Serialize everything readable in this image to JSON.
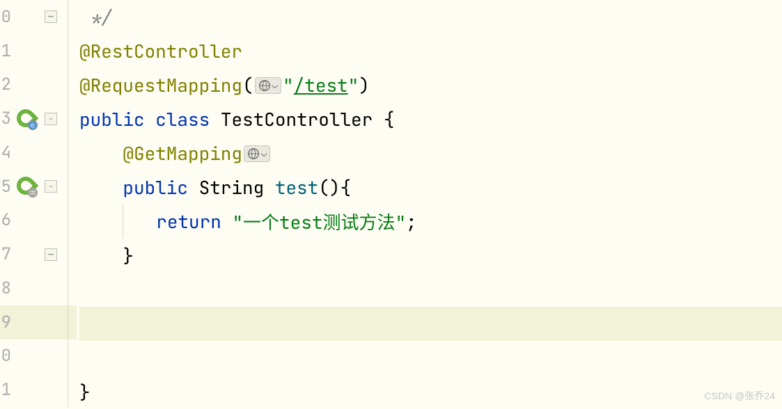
{
  "lines": {
    "l0": {
      "num": "0",
      "comment": " */"
    },
    "l1": {
      "num": "1",
      "annotation": "@RestController"
    },
    "l2": {
      "num": "2",
      "annotation": "@RequestMapping",
      "paren_open": "(",
      "string_quote1": "\"",
      "string_path": "/test",
      "string_quote2": "\"",
      "paren_close": ")"
    },
    "l3": {
      "num": "3",
      "kw_public": "public",
      "kw_class": "class",
      "classname": "TestController",
      "brace": " {"
    },
    "l4": {
      "num": "4",
      "annotation": "@GetMapping"
    },
    "l5": {
      "num": "5",
      "kw_public": "public",
      "type": "String",
      "method": "test",
      "parens": "(){"
    },
    "l6": {
      "num": "6",
      "kw_return": "return",
      "string": "\"一个test测试方法\"",
      "semi": ";"
    },
    "l7": {
      "num": "7",
      "brace": "}"
    },
    "l8": {
      "num": "8"
    },
    "l9": {
      "num": "9"
    },
    "l10": {
      "num": "0"
    },
    "l11": {
      "num": "1",
      "brace": "}"
    }
  },
  "watermark": "CSDN @张乔24"
}
